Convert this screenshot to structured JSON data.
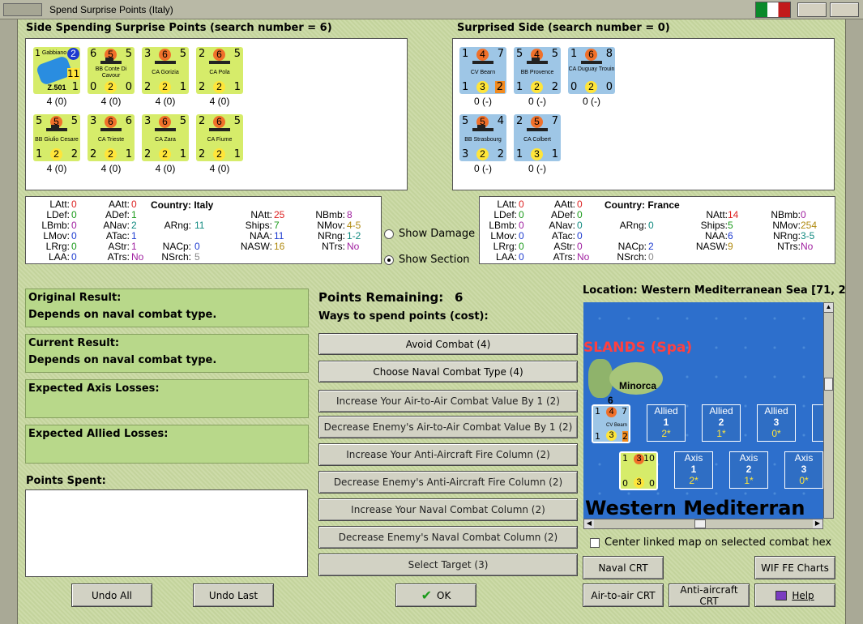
{
  "window": {
    "title": "Spend Surprise Points (Italy)"
  },
  "left_header": "Side Spending Surprise Points (search number = 6)",
  "right_header": "Surprised Side (search number = 0)",
  "italy_units": [
    {
      "name": "Gabbiano",
      "sub": "Z.501",
      "a": "1",
      "b": "2",
      "c": "11",
      "d": "1",
      "under": "4 (0)"
    },
    {
      "name": "BB Conte Di Cavour",
      "a": "6",
      "b": "5",
      "c": "5",
      "d": "0",
      "e": "2",
      "f": "0",
      "under": "4 (0)"
    },
    {
      "name": "CA Gorizia",
      "a": "3",
      "b": "6",
      "c": "5",
      "d": "2",
      "e": "2",
      "f": "1",
      "under": "4 (0)"
    },
    {
      "name": "CA Pola",
      "a": "2",
      "b": "6",
      "c": "5",
      "d": "2",
      "e": "2",
      "f": "1",
      "under": "4 (0)"
    },
    {
      "name": "BB Giulio Cesare",
      "a": "5",
      "b": "5",
      "c": "5",
      "d": "1",
      "e": "2",
      "f": "2",
      "under": "4 (0)"
    },
    {
      "name": "CA Trieste",
      "a": "3",
      "b": "6",
      "c": "6",
      "d": "2",
      "e": "2",
      "f": "1",
      "under": "4 (0)"
    },
    {
      "name": "CA Zara",
      "a": "3",
      "b": "6",
      "c": "5",
      "d": "2",
      "e": "2",
      "f": "1",
      "under": "4 (0)"
    },
    {
      "name": "CA Fiume",
      "a": "2",
      "b": "6",
      "c": "5",
      "d": "2",
      "e": "2",
      "f": "1",
      "under": "4 (0)"
    }
  ],
  "france_units": [
    {
      "name": "CV Bearn",
      "a": "1",
      "b": "4",
      "c": "7",
      "d": "1",
      "e": "3",
      "f": "2",
      "under": "0 (-)"
    },
    {
      "name": "BB Provence",
      "a": "5",
      "b": "4",
      "c": "5",
      "d": "1",
      "e": "2",
      "f": "2",
      "under": "0 (-)"
    },
    {
      "name": "CA Duguay Trouin",
      "a": "1",
      "b": "6",
      "c": "8",
      "d": "0",
      "e": "2",
      "f": "0",
      "under": "0 (-)"
    },
    {
      "name": "BB Strasbourg",
      "a": "5",
      "b": "5",
      "c": "4",
      "d": "3",
      "e": "2",
      "f": "2",
      "under": "0 (-)"
    },
    {
      "name": "CA Colbert",
      "a": "2",
      "b": "5",
      "c": "7",
      "d": "1",
      "e": "3",
      "f": "1",
      "under": "0 (-)"
    }
  ],
  "italy_stats": {
    "country_label": "Country: Italy",
    "latt": "LAtt:",
    "latt_v": "0",
    "ldef": "LDef:",
    "ldef_v": "0",
    "lbmb": "LBmb:",
    "lbmb_v": "0",
    "lmov": "LMov:",
    "lmov_v": "0",
    "lrrg": "LRrg:",
    "lrrg_v": "0",
    "laa": "LAA:",
    "laa_v": "0",
    "aatt": "AAtt:",
    "aatt_v": "0",
    "adef": "ADef:",
    "adef_v": "1",
    "anav": "ANav:",
    "anav_v": "2",
    "atac": "ATac:",
    "atac_v": "1",
    "astr": "AStr:",
    "astr_v": "1",
    "atrs": "ATrs:",
    "atrs_v": "No",
    "arng": "ARng:",
    "arng_v": "11",
    "nacp": "NACp:",
    "nacp_v": "0",
    "nsrch": "NSrch:",
    "nsrch_v": "5",
    "natt": "NAtt:",
    "natt_v": "25",
    "ships": "Ships:",
    "ships_v": "7",
    "naa": "NAA:",
    "naa_v": "11",
    "nasw": "NASW:",
    "nasw_v": "16",
    "nbmb": "NBmb:",
    "nbmb_v": "8",
    "nmov": "NMov:",
    "nmov_v": "4-5",
    "nrng": "NRng:",
    "nrng_v": "1-2",
    "ntrs": "NTrs:",
    "ntrs_v": "No"
  },
  "france_stats": {
    "country_label": "Country: France",
    "latt": "LAtt:",
    "latt_v": "0",
    "ldef": "LDef:",
    "ldef_v": "0",
    "lbmb": "LBmb:",
    "lbmb_v": "0",
    "lmov": "LMov:",
    "lmov_v": "0",
    "lrrg": "LRrg:",
    "lrrg_v": "0",
    "laa": "LAA:",
    "laa_v": "0",
    "aatt": "AAtt:",
    "aatt_v": "0",
    "adef": "ADef:",
    "adef_v": "0",
    "anav": "ANav:",
    "anav_v": "0",
    "atac": "ATac:",
    "atac_v": "0",
    "astr": "AStr:",
    "astr_v": "0",
    "atrs": "ATrs:",
    "atrs_v": "No",
    "arng": "ARng:",
    "arng_v": "0",
    "nacp": "NACp:",
    "nacp_v": "2",
    "nsrch": "NSrch:",
    "nsrch_v": "0",
    "natt": "NAtt:",
    "natt_v": "14",
    "ships": "Ships:",
    "ships_v": "5",
    "naa": "NAA:",
    "naa_v": "6",
    "nasw": "NASW:",
    "nasw_v": "9",
    "nbmb": "NBmb:",
    "nbmb_v": "0",
    "nmov": "NMov:",
    "nmov_v": "254",
    "nrng": "NRng:",
    "nrng_v": "3-5",
    "ntrs": "NTrs:",
    "ntrs_v": "No"
  },
  "options": {
    "show_damage": "Show Damage",
    "show_section": "Show Section",
    "selected": "show_section"
  },
  "results": {
    "original_label": "Original Result:",
    "original_text": "Depends on naval combat type.",
    "current_label": "Current Result:",
    "current_text": "Depends on naval combat type.",
    "axis_label": "Expected Axis Losses:",
    "allied_label": "Expected Allied Losses:",
    "points_spent_label": "Points Spent:"
  },
  "points": {
    "label": "Points Remaining:",
    "value": "6",
    "ways_label": "Ways to spend points (cost):"
  },
  "spend_buttons": [
    "Avoid Combat (4)",
    "Choose Naval Combat Type (4)",
    "Increase Your Air-to-Air Combat Value By 1 (2)",
    "Decrease Enemy's Air-to-Air Combat Value By 1 (2)",
    "Increase Your Anti-Aircraft Fire Column (2)",
    "Decrease Enemy's Anti-Aircraft Fire Column (2)",
    "Increase Your Naval Combat Column (2)",
    "Decrease Enemy's Naval Combat Column (2)",
    "Select Target (3)"
  ],
  "bottom": {
    "undo_all": "Undo All",
    "undo_last": "Undo Last",
    "ok": "OK"
  },
  "map": {
    "location": "Location: Western Mediterranean Sea [71, 2",
    "islands": "SLANDS (Spa)",
    "minorca": "Minorca",
    "sea_label": "Western Mediterran",
    "stack_count": "6",
    "allied_boxes": [
      {
        "t": "Allied",
        "n": "1",
        "s": "2*"
      },
      {
        "t": "Allied",
        "n": "2",
        "s": "1*"
      },
      {
        "t": "Allied",
        "n": "3",
        "s": "0*"
      }
    ],
    "axis_boxes": [
      {
        "t": "Axis",
        "n": "1",
        "s": "2*"
      },
      {
        "t": "Axis",
        "n": "2",
        "s": "1*"
      },
      {
        "t": "Axis",
        "n": "3",
        "s": "0*"
      }
    ],
    "allied_counter": {
      "name": "CV Bearn",
      "a": "1",
      "b": "4",
      "c": "7",
      "d": "1",
      "e": "3",
      "f": "2"
    },
    "axis_counter": {
      "a": "1",
      "b": "3",
      "c": "10",
      "d": "0",
      "e": "3",
      "f": "0"
    },
    "center_check_label": "Center linked map on selected combat hex"
  },
  "charts": {
    "naval_crt": "Naval CRT",
    "wif_fe": "WIF FE Charts",
    "air_crt": "Air-to-air CRT",
    "aa_crt": "Anti-aircraft CRT",
    "help": "Help"
  },
  "colors": {
    "italy_counter": "#d6ec6a",
    "france_counter": "#9ec6e6",
    "panel_green": "#b8d88a",
    "map_sea": "#2d6fcc"
  }
}
